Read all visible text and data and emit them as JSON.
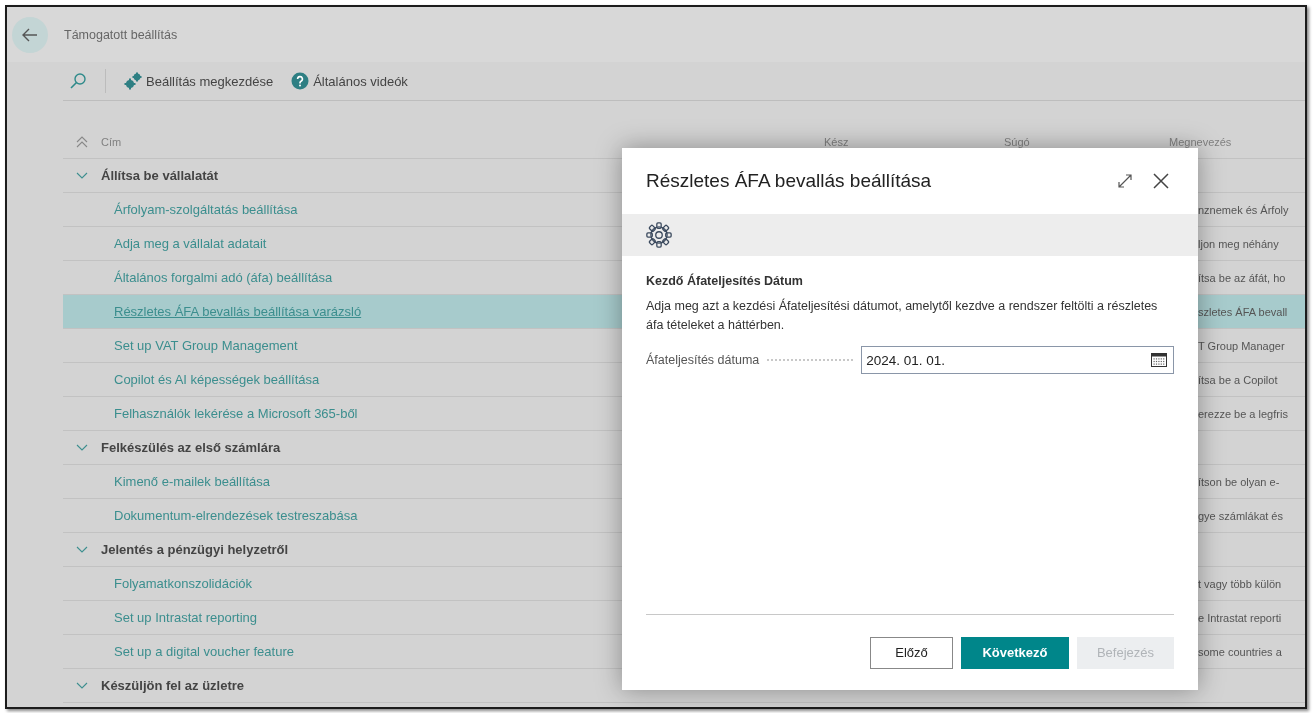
{
  "page": {
    "title": "Támogatott beállítás"
  },
  "toolbar": [
    {
      "kind": "search"
    },
    {
      "kind": "setup",
      "label": "Beállítás megkezdése"
    },
    {
      "kind": "help",
      "label": "Általános videók"
    }
  ],
  "table": {
    "columns": [
      {
        "label": "Cím"
      },
      {
        "label": "Kész"
      },
      {
        "label": "Súgó"
      },
      {
        "label": "Megnevezés"
      }
    ],
    "groups": [
      {
        "title": "Állítsa be vállalatát",
        "expanded": true,
        "children": [
          {
            "title": "Árfolyam-szolgáltatás beállítása",
            "description": "nznemek és Árfoly",
            "selected": false
          },
          {
            "title": "Adja meg a vállalat adatait",
            "description": "ljon meg néhány",
            "selected": false
          },
          {
            "title": "Általános forgalmi adó (áfa) beállítása",
            "description": "ítsa be az áfát, ho",
            "selected": false
          },
          {
            "title": "Részletes ÁFA bevallás beállítása varázsló",
            "description": "szletes ÁFA bevall",
            "selected": true
          },
          {
            "title": "Set up VAT Group Management",
            "description": "T Group Manager",
            "selected": false
          },
          {
            "title": "Copilot és AI képességek beállítása",
            "description": "ítsa be a Copilot",
            "selected": false
          },
          {
            "title": "Felhasználók lekérése a Microsoft 365-ből",
            "description": "erezze be a legfris",
            "selected": false
          }
        ]
      },
      {
        "title": "Felkészülés az első számlára",
        "expanded": true,
        "children": [
          {
            "title": "Kimenő e-mailek beállítása",
            "description": "ítson be olyan e-",
            "selected": false
          },
          {
            "title": "Dokumentum-elrendezések testreszabása",
            "description": "gye számlákat és",
            "selected": false
          }
        ]
      },
      {
        "title": "Jelentés a pénzügyi helyzetről",
        "expanded": true,
        "children": [
          {
            "title": "Folyamatkonszolidációk",
            "description": "t vagy több külön",
            "selected": false
          },
          {
            "title": "Set up Intrastat reporting",
            "description": "e Intrastat reporti",
            "selected": false
          },
          {
            "title": "Set up a digital voucher feature",
            "description": "some countries a",
            "selected": false
          }
        ]
      },
      {
        "title": "Készüljön fel az üzletre",
        "expanded": true
      }
    ]
  },
  "dialog": {
    "title": "Részletes ÁFA bevallás beállítása",
    "section": {
      "heading": "Kezdő Áfateljesítés Dátum",
      "description": "Adja meg azt a kezdési Áfateljesítési dátumot, amelytől kezdve a rendszer feltölti a részletes áfa tételeket a háttérben."
    },
    "fields": [
      {
        "label": "Áfateljesítés dátuma",
        "value": "2024. 01. 01."
      }
    ],
    "buttons": [
      {
        "label": "Előző",
        "kind": "default",
        "disabled": false
      },
      {
        "label": "Következő",
        "kind": "primary",
        "disabled": false
      },
      {
        "label": "Befejezés",
        "kind": "default",
        "disabled": true
      }
    ]
  }
}
